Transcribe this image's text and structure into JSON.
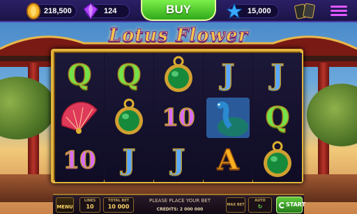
{
  "topbar": {
    "coins_value": "218,500",
    "gems_value": "124",
    "buy_label": "BUY",
    "stars_value": "15,000"
  },
  "game": {
    "title": "Lotus Flower",
    "reels": [
      [
        "Q",
        "fan",
        "10"
      ],
      [
        "Q",
        "amulet",
        "J"
      ],
      [
        "amulet",
        "10",
        "J"
      ],
      [
        "J",
        "peacock",
        "A"
      ],
      [
        "J",
        "Q",
        "amulet"
      ]
    ]
  },
  "bottombar": {
    "menu_label": "MENU",
    "lines_label": "LINES",
    "lines_value": "10",
    "total_bet_label": "TOTAL BET",
    "total_bet_value": "10 000",
    "message": "PLEASE PLACE YOUR BET",
    "credits_text": "CREDITS: 2 000 000",
    "max_bet_label": "MAX BET",
    "auto_label": "AUTO",
    "start_label": "START"
  },
  "colors": {
    "accent": "#e3b43c",
    "buy": "#3fbf22",
    "topbar": "#231a58"
  }
}
